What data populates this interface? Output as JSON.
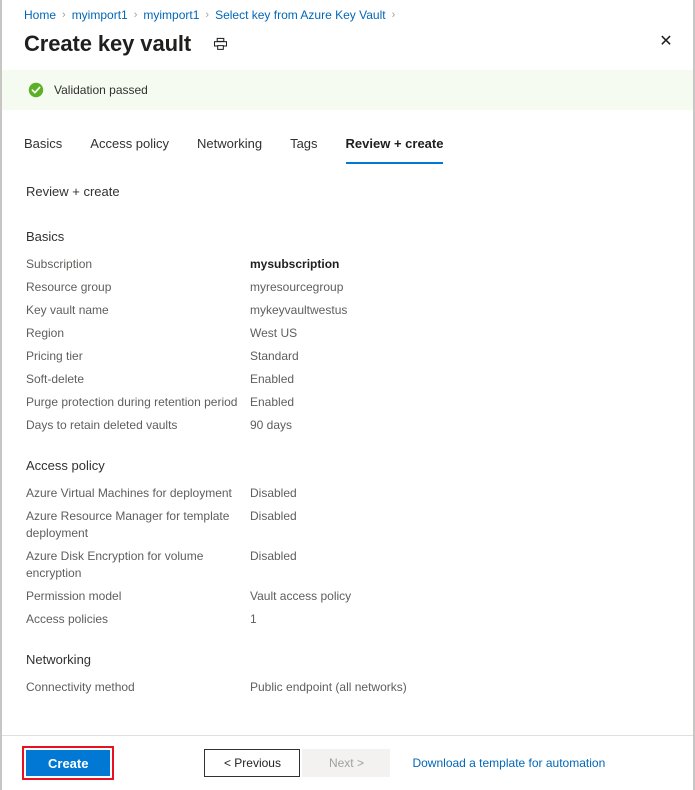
{
  "breadcrumb": {
    "items": [
      {
        "label": "Home"
      },
      {
        "label": "myimport1"
      },
      {
        "label": "myimport1"
      },
      {
        "label": "Select key from Azure Key Vault"
      }
    ],
    "separator": "›"
  },
  "header": {
    "title": "Create key vault",
    "print_icon": "printer-icon",
    "close_icon": "close-icon",
    "close_glyph": "✕"
  },
  "validation": {
    "message": "Validation passed",
    "icon": "success-check-icon",
    "background_color": "#f5fbf1",
    "icon_color": "#5cb025"
  },
  "tabs": [
    {
      "label": "Basics",
      "active": false
    },
    {
      "label": "Access policy",
      "active": false
    },
    {
      "label": "Networking",
      "active": false
    },
    {
      "label": "Tags",
      "active": false
    },
    {
      "label": "Review + create",
      "active": true
    }
  ],
  "accent_color": "#0078d4",
  "main": {
    "review_heading": "Review + create",
    "sections": [
      {
        "title": "Basics",
        "rows": [
          {
            "label": "Subscription",
            "value": "mysubscription",
            "strong": true
          },
          {
            "label": "Resource group",
            "value": "myresourcegroup",
            "strong": false
          },
          {
            "label": "Key vault name",
            "value": "mykeyvaultwestus",
            "strong": false
          },
          {
            "label": "Region",
            "value": "West US",
            "strong": false
          },
          {
            "label": "Pricing tier",
            "value": "Standard",
            "strong": false
          },
          {
            "label": "Soft-delete",
            "value": "Enabled",
            "strong": false
          },
          {
            "label": "Purge protection during retention period",
            "value": "Enabled",
            "strong": false
          },
          {
            "label": "Days to retain deleted vaults",
            "value": "90 days",
            "strong": false
          }
        ]
      },
      {
        "title": "Access policy",
        "rows": [
          {
            "label": "Azure Virtual Machines for deployment",
            "value": "Disabled",
            "strong": false
          },
          {
            "label": "Azure Resource Manager for template deployment",
            "value": "Disabled",
            "strong": false
          },
          {
            "label": "Azure Disk Encryption for volume encryption",
            "value": "Disabled",
            "strong": false
          },
          {
            "label": "Permission model",
            "value": "Vault access policy",
            "strong": false
          },
          {
            "label": "Access policies",
            "value": "1",
            "strong": false
          }
        ]
      },
      {
        "title": "Networking",
        "rows": [
          {
            "label": "Connectivity method",
            "value": "Public endpoint (all networks)",
            "strong": false
          }
        ]
      }
    ]
  },
  "footer": {
    "create_label": "Create",
    "previous_label": "< Previous",
    "next_label": "Next >",
    "download_link_label": "Download a template for automation",
    "highlight_color": "#e81123"
  }
}
